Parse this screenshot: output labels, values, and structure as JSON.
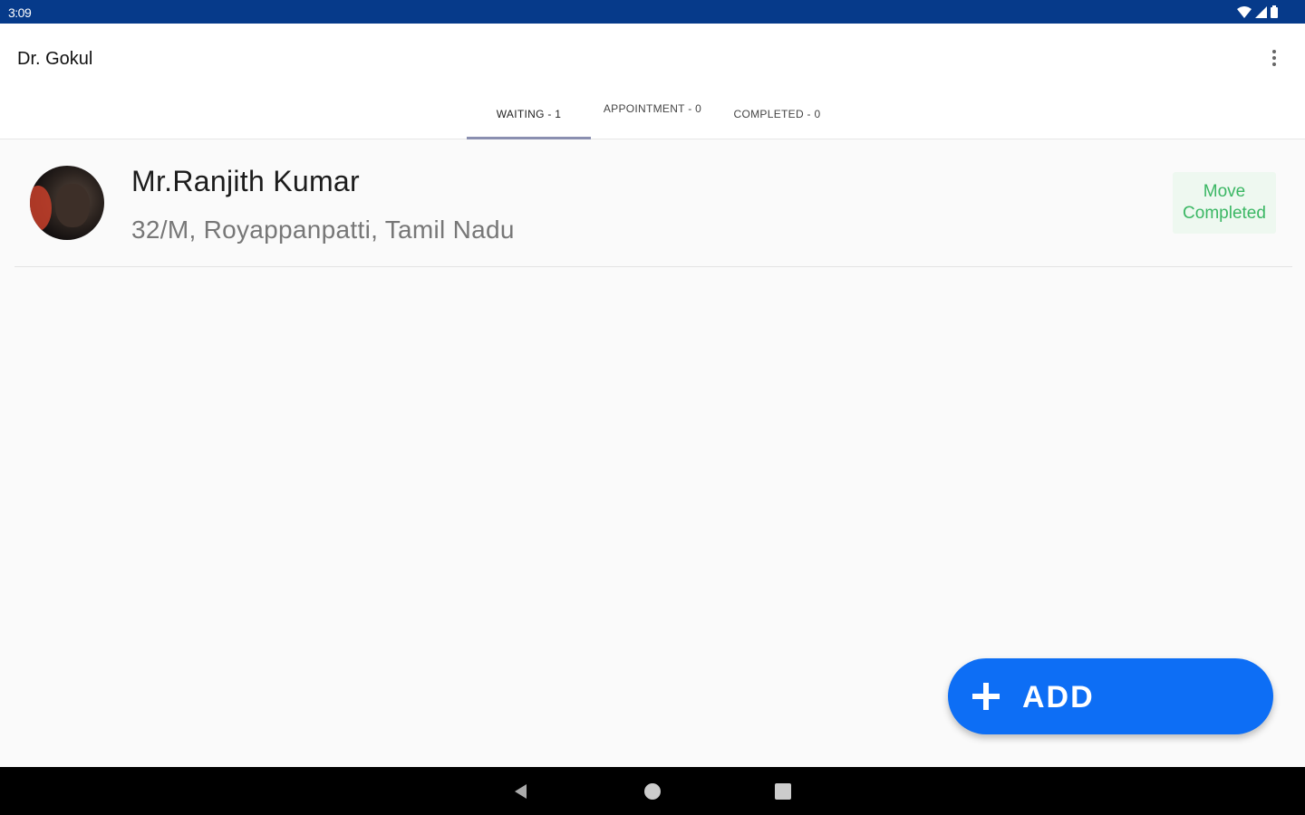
{
  "status_bar": {
    "time": "3:09",
    "icons": [
      "wifi-icon",
      "signal-icon",
      "battery-icon"
    ],
    "color": "#063a8a"
  },
  "app_bar": {
    "title": "Dr. Gokul",
    "menu_icon": "more-vert-icon"
  },
  "tabs": [
    {
      "label": "WAITING - 1",
      "active": true
    },
    {
      "label": "APPOINTMENT - 0",
      "active": false
    },
    {
      "label": "COMPLETED - 0",
      "active": false
    }
  ],
  "patients": [
    {
      "name": "Mr.Ranjith Kumar",
      "details": "32/M, Royappanpatti, Tamil Nadu",
      "action_label": "Move Completed"
    }
  ],
  "fab": {
    "label": "ADD",
    "icon": "plus-icon",
    "color": "#0d6ef5"
  },
  "nav_bar": {
    "buttons": [
      "back-icon",
      "home-icon",
      "recents-icon"
    ]
  },
  "colors": {
    "accent_green": "#3bb764",
    "tab_indicator": "#8a8fb0"
  }
}
